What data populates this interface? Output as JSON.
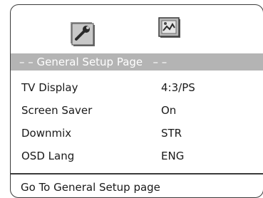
{
  "tabs": [
    {
      "icon": "wrench-settings-icon",
      "label": ""
    },
    {
      "icon": "video-settings-icon",
      "label": ""
    }
  ],
  "header": {
    "title": "– – General Setup Page   – –"
  },
  "settings": [
    {
      "label": "TV Display",
      "value": "4:3/PS"
    },
    {
      "label": "Screen Saver",
      "value": "On"
    },
    {
      "label": "Downmix",
      "value": "STR"
    },
    {
      "label": "OSD Lang",
      "value": "ENG"
    }
  ],
  "status": {
    "text": "Go To General Setup page"
  },
  "colors": {
    "header_bg": "#b4b4b4",
    "header_text": "#ffffff",
    "frame": "#3a3a3a"
  }
}
